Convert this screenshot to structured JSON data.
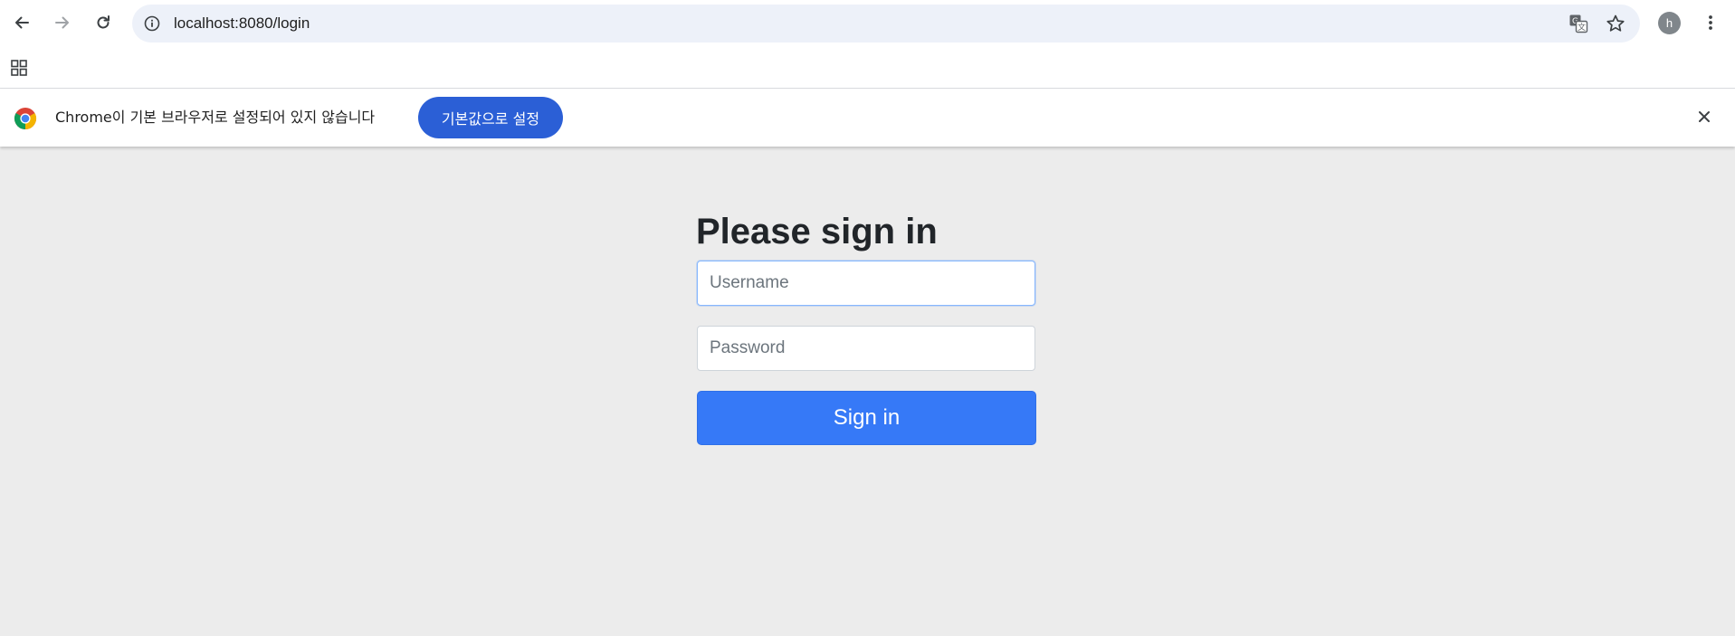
{
  "browser": {
    "url": "localhost:8080/login",
    "profile_initial": "h",
    "icons": [
      "back-arrow-icon",
      "forward-arrow-icon",
      "reload-icon",
      "site-info-icon",
      "translate-icon",
      "bookmark-star-icon",
      "menu-kebab-icon",
      "apps-grid-icon"
    ]
  },
  "infobar": {
    "message": "Chrome이 기본 브라우저로 설정되어 있지 않습니다",
    "button_label": "기본값으로 설정",
    "accent_color": "#2b5fd6"
  },
  "login": {
    "title": "Please sign in",
    "username_placeholder": "Username",
    "password_placeholder": "Password",
    "submit_label": "Sign in",
    "button_color": "#3679f7"
  }
}
